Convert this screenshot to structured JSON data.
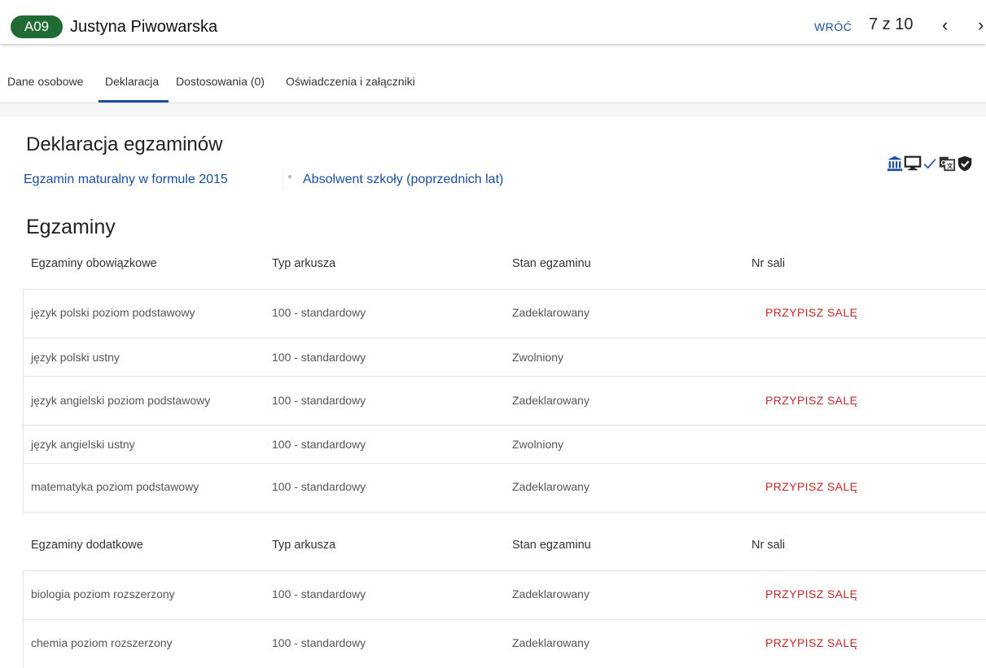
{
  "header": {
    "badge": "A09",
    "name": "Justyna Piwowarska",
    "back_label": "WRÓĆ",
    "counter": "7 z 10",
    "prev_symbol": "‹",
    "next_symbol": "›"
  },
  "tabs": [
    {
      "label": "Dane osobowe",
      "active": false
    },
    {
      "label": "Deklaracja",
      "active": true
    },
    {
      "label": "Dostosowania (0)",
      "active": false
    },
    {
      "label": "Oświadczenia i załączniki",
      "active": false
    }
  ],
  "declaration": {
    "title": "Deklaracja egzaminów",
    "exam_type": "Egzamin maturalny w formule 2015",
    "candidate_type": "Absolwent szkoły (poprzednich lat)",
    "status_icons": [
      "bank-icon",
      "presentation-icon",
      "checkmark-icon",
      "translate-icon",
      "shield-check-icon"
    ],
    "icon_color": "#1c4fa0"
  },
  "exams": {
    "title": "Egzaminy",
    "mandatory": {
      "headers": [
        "Egzaminy obowiązkowe",
        "Typ arkusza",
        "Stan egzaminu",
        "Nr sali"
      ],
      "rows": [
        {
          "subject": "język polski poziom podstawowy",
          "sheet": "100 - standardowy",
          "status": "Zadeklarowany",
          "room": "PRZYPISZ SALĘ"
        },
        {
          "subject": "język polski ustny",
          "sheet": "100 - standardowy",
          "status": "Zwolniony",
          "room": ""
        },
        {
          "subject": "język angielski poziom podstawowy",
          "sheet": "100 - standardowy",
          "status": "Zadeklarowany",
          "room": "PRZYPISZ SALĘ"
        },
        {
          "subject": "język angielski ustny",
          "sheet": "100 - standardowy",
          "status": "Zwolniony",
          "room": ""
        },
        {
          "subject": "matematyka poziom podstawowy",
          "sheet": "100 - standardowy",
          "status": "Zadeklarowany",
          "room": "PRZYPISZ SALĘ"
        }
      ]
    },
    "additional": {
      "headers": [
        "Egzaminy dodatkowe",
        "Typ arkusza",
        "Stan egzaminu",
        "Nr sali"
      ],
      "rows": [
        {
          "subject": "biologia poziom rozszerzony",
          "sheet": "100 - standardowy",
          "status": "Zadeklarowany",
          "room": "PRZYPISZ SALĘ"
        },
        {
          "subject": "chemia poziom rozszerzony",
          "sheet": "100 - standardowy",
          "status": "Zadeklarowany",
          "room": "PRZYPISZ SALĘ"
        }
      ]
    }
  },
  "colors": {
    "accent": "#1c4fa0",
    "badge": "#1f6b33",
    "action": "#c62828"
  }
}
